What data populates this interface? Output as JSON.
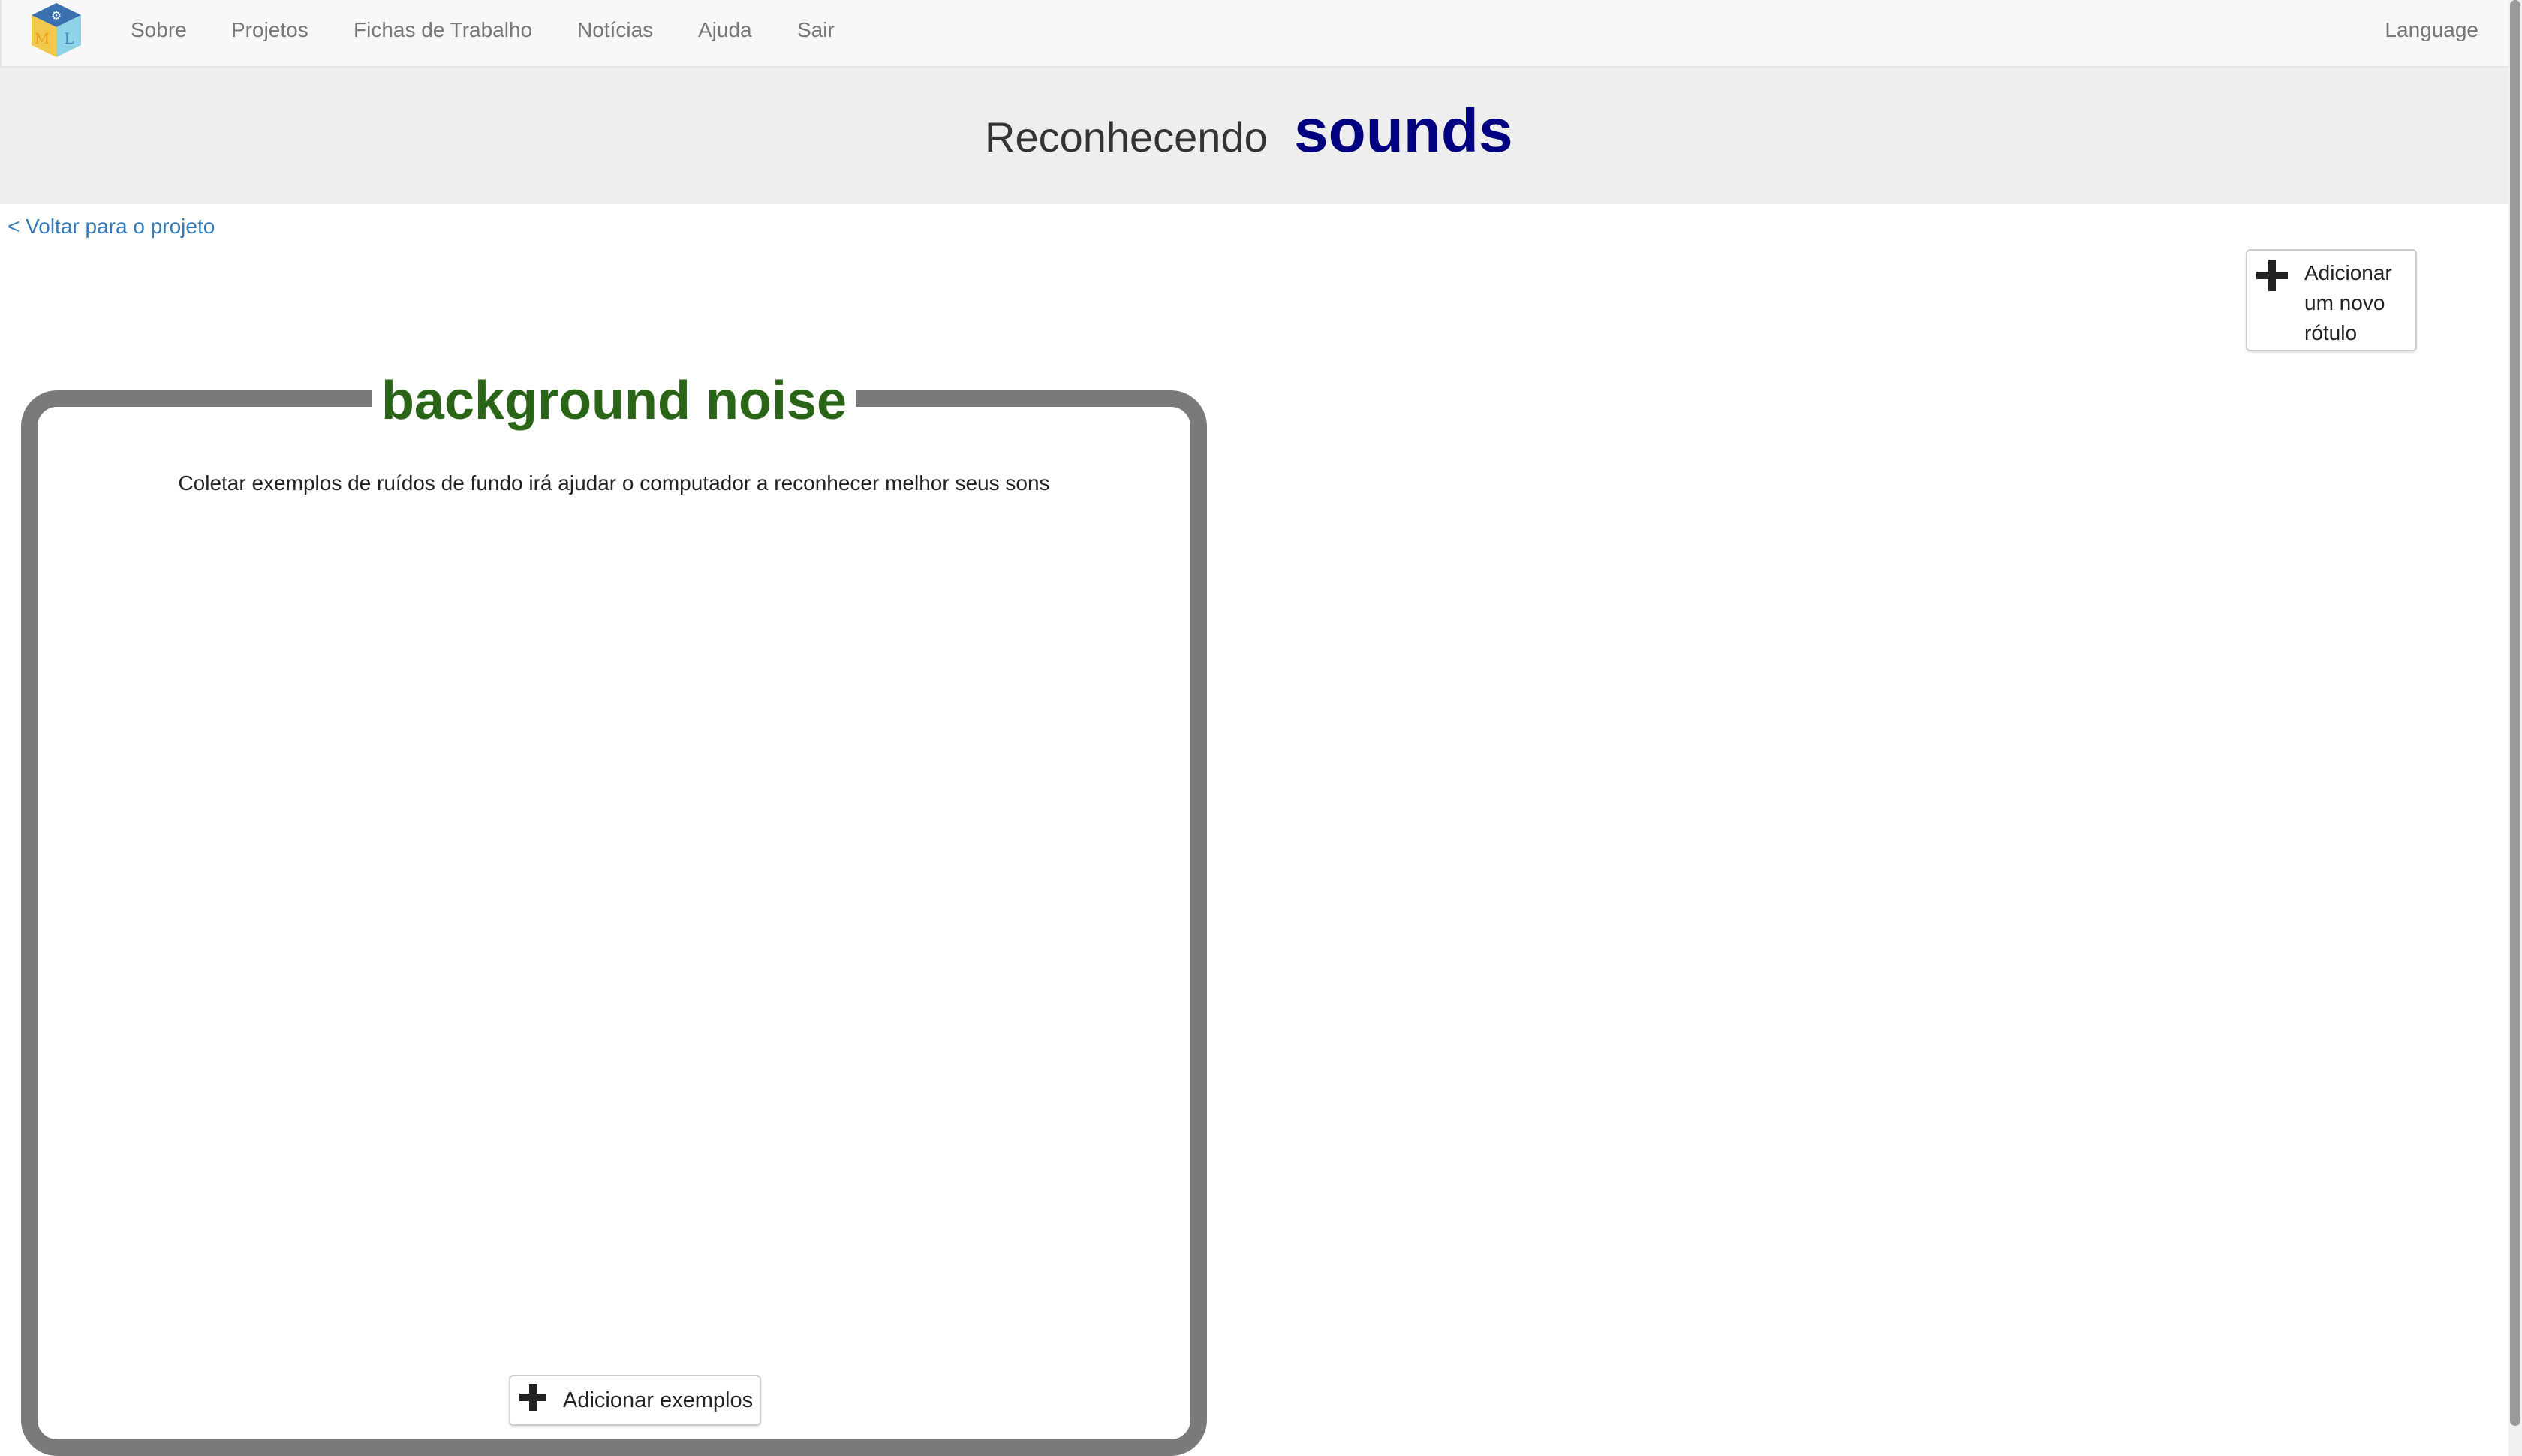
{
  "nav": {
    "logo_icon": "ml-cube-logo-icon",
    "items": [
      {
        "label": "Sobre"
      },
      {
        "label": "Projetos"
      },
      {
        "label": "Fichas de Trabalho"
      },
      {
        "label": "Notícias"
      },
      {
        "label": "Ajuda"
      },
      {
        "label": "Sair"
      }
    ],
    "language": "Language"
  },
  "header": {
    "prefix": "Reconhecendo",
    "project_name": "sounds"
  },
  "back_link": "< Voltar para o projeto",
  "add_label": {
    "icon": "plus-icon",
    "text": "Adicionar um novo rótulo"
  },
  "bucket": {
    "title": "background noise",
    "description": "Coletar exemplos de ruídos de fundo irá ajudar o computador a reconhecer melhor seus sons",
    "add_examples": {
      "icon": "plus-icon",
      "text": "Adicionar exemplos"
    }
  },
  "colors": {
    "title_blue": "#000080",
    "label_green": "#2a6416",
    "link_blue": "#337ab7",
    "bucket_border": "#7a7a7a"
  }
}
